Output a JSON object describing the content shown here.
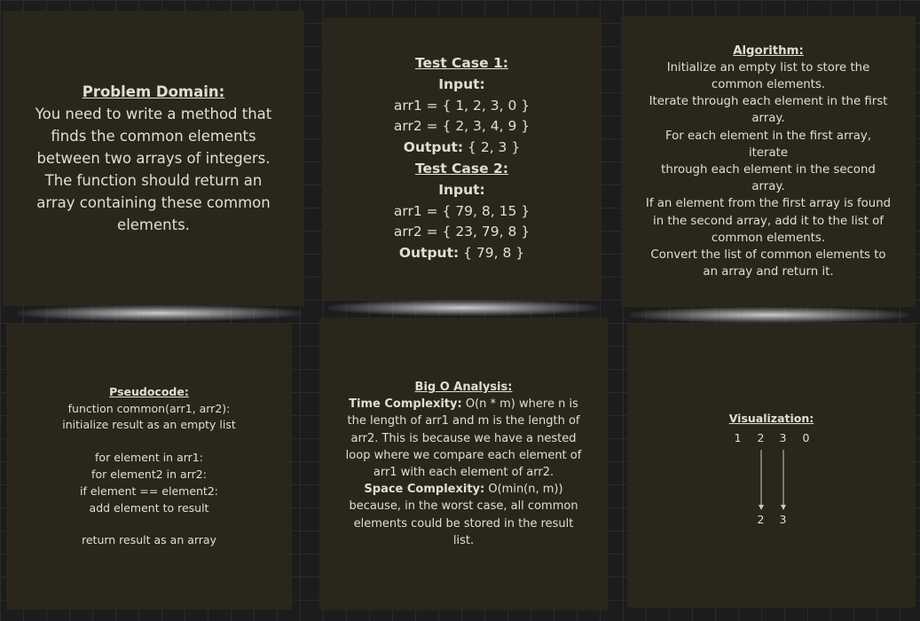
{
  "problem": {
    "title": "Problem Domain:",
    "lines": [
      "You need to write a method that",
      "finds the common elements",
      "between two arrays of integers.",
      "The function should return an",
      "array containing these common",
      "elements."
    ]
  },
  "tests": {
    "case1_title": "Test Case 1:",
    "case1_input_label": "Input:",
    "case1_arr1": "arr1 = { 1, 2, 3, 0 }",
    "case1_arr2": "arr2 = { 2, 3, 4, 9 }",
    "case1_output_label": "Output:",
    "case1_output": " { 2, 3 }",
    "case2_title": "Test Case 2:",
    "case2_input_label": "Input:",
    "case2_arr1": "arr1 = { 79, 8, 15 }",
    "case2_arr2": "arr2 = { 23, 79, 8 }",
    "case2_output_label": "Output:",
    "case2_output": " { 79, 8 }"
  },
  "algorithm": {
    "title": "Algorithm:",
    "lines": [
      "Initialize an empty list to store the",
      "common elements.",
      "Iterate through each element in the first",
      "array.",
      "For each element in the first array, iterate",
      "through each element in the second",
      "array.",
      "If an element from the first array is found",
      "in the second array, add it to the list of",
      "common elements.",
      "Convert the list of common elements to",
      "an array and return it."
    ]
  },
  "pseudocode": {
    "title": "Pseudocode:",
    "line1": "function common(arr1, arr2):",
    "line2": "initialize result as an empty list",
    "line3": "for element in arr1:",
    "line4": "for element2 in arr2:",
    "line5": "if element == element2:",
    "line6": "add element to result",
    "line7": "return result as an array"
  },
  "bigo": {
    "title": "Big O Analysis:",
    "time_label": "Time Complexity:",
    "time_lines": [
      " O(n * m) where n is",
      "the length of arr1 and m is the length of",
      "arr2. This is because we have a nested",
      "loop where we compare each element of",
      "arr1 with each element of arr2."
    ],
    "space_label": "Space Complexity:",
    "space_lines": [
      " O(min(n, m))",
      "because, in the worst case, all common",
      "elements could be stored in the result",
      "list."
    ]
  },
  "visualization": {
    "title": "Visualization:",
    "top_values": [
      "1",
      "2",
      "3",
      "0"
    ],
    "bottom_values": [
      "2",
      "3"
    ]
  },
  "colors": {
    "background": "#1c1c1c",
    "note": "#2a261b",
    "text": "#e2ddd2"
  }
}
